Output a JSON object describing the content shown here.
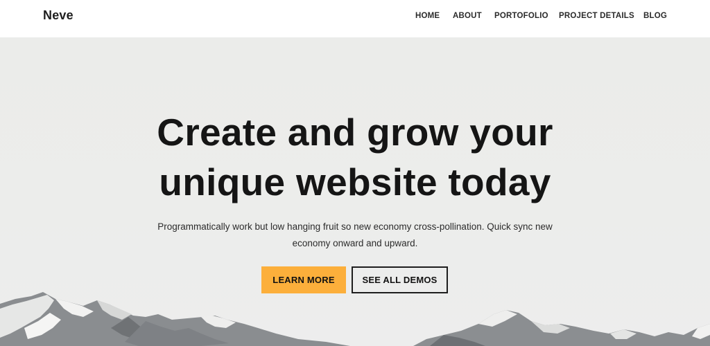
{
  "site": {
    "logo": "Neve"
  },
  "nav": {
    "items": [
      "HOME",
      "ABOUT",
      "PORTOFOLIO",
      "PROJECT DETAILS",
      "BLOG"
    ]
  },
  "hero": {
    "headline_line1": "Create and grow your",
    "headline_line2": "unique website today",
    "subtext": "Programmatically work but low hanging fruit so new economy cross-pollination. Quick sync new economy onward and upward.",
    "primary_button": "LEARN MORE",
    "secondary_button": "SEE ALL DEMOS"
  },
  "colors": {
    "accent": "#fcaf3b",
    "text": "#151515",
    "hero_background": "#ecedeb",
    "header_background": "#ffffff"
  }
}
